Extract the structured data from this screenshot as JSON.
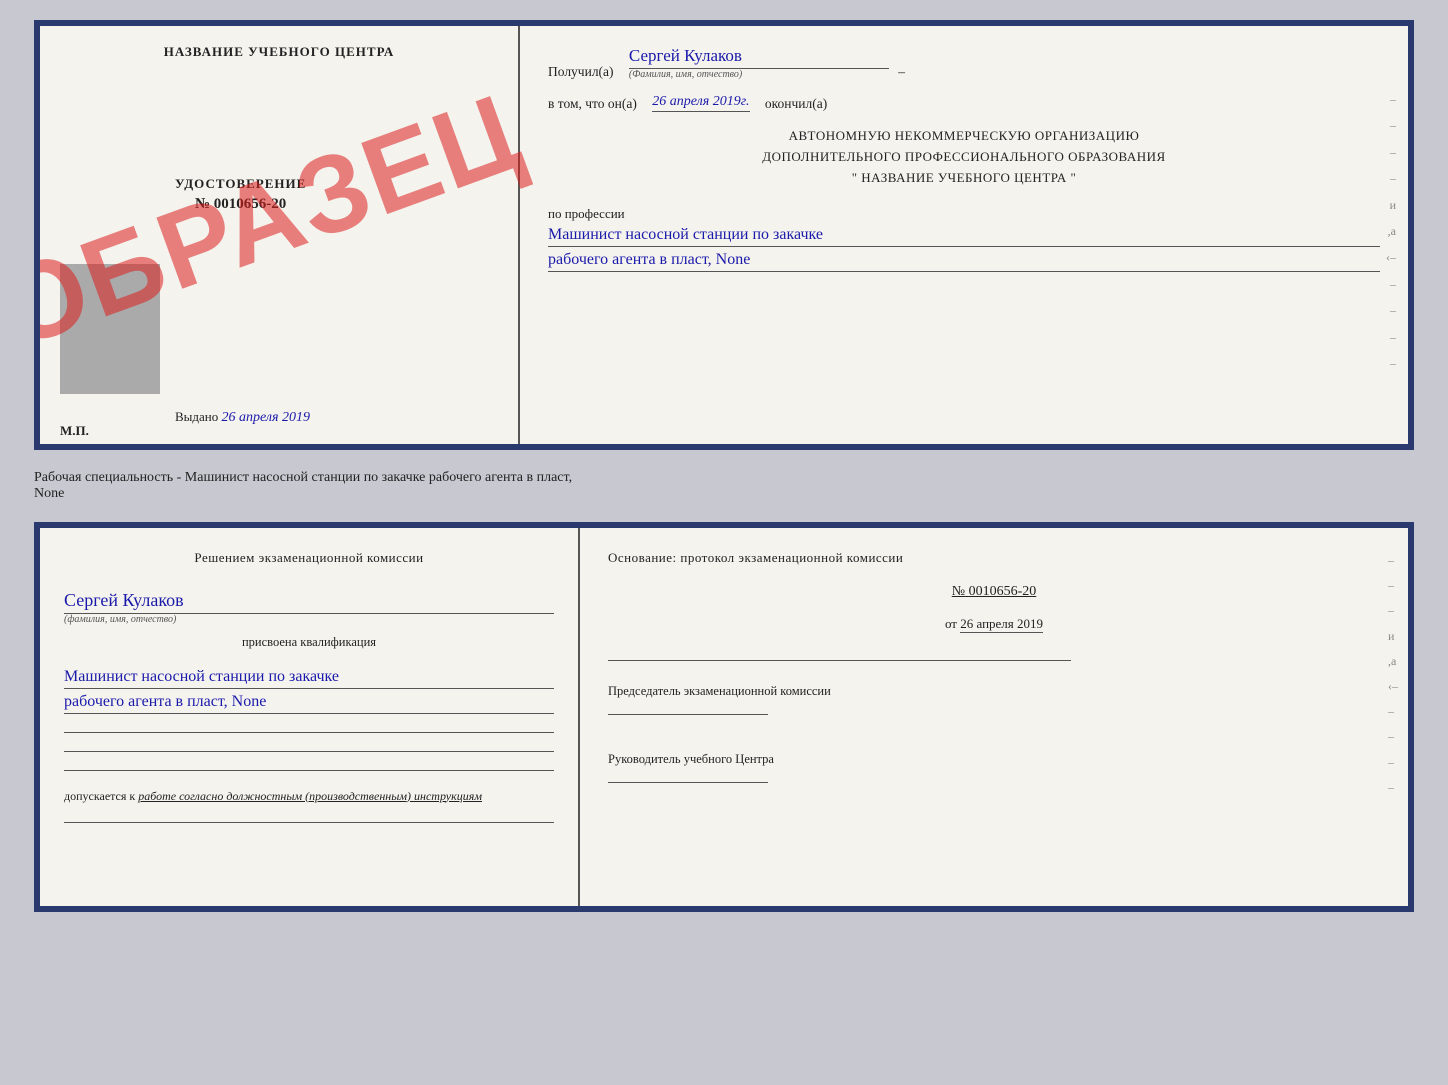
{
  "top_cert": {
    "left": {
      "title": "НАЗВАНИЕ УЧЕБНОГО ЦЕНТРА",
      "stamp": "ОБРАЗЕЦ",
      "udost_label": "УДОСТОВЕРЕНИЕ",
      "udost_num": "№ 0010656-20",
      "vydano_label": "Выдано",
      "vydano_date": "26 апреля 2019",
      "mp_label": "М.П."
    },
    "right": {
      "poluchil_label": "Получил(а)",
      "poluchil_value": "Сергей Кулаков",
      "familiya_label": "(Фамилия, имя, отчество)",
      "vtom_label": "в том, что он(а)",
      "date_value": "26 апреля 2019г.",
      "okonchil_label": "окончил(а)",
      "org_line1": "АВТОНОМНУЮ НЕКОММЕРЧЕСКУЮ ОРГАНИЗАЦИЮ",
      "org_line2": "ДОПОЛНИТЕЛЬНОГО ПРОФЕССИОНАЛЬНОГО ОБРАЗОВАНИЯ",
      "org_line3": "\"  НАЗВАНИЕ УЧЕБНОГО ЦЕНТРА  \"",
      "profession_label": "по профессии",
      "profession_line1": "Машинист насосной станции по закачке",
      "profession_line2": "рабочего агента в пласт, None"
    }
  },
  "caption": {
    "text": "Рабочая специальность - Машинист насосной станции по закачке рабочего агента в пласт,",
    "text2": "None"
  },
  "bottom_cert": {
    "left": {
      "komissia_text": "Решением экзаменационной комиссии",
      "name_value": "Сергей Кулаков",
      "familiya_label": "(фамилия, имя, отчество)",
      "prisvoena_text": "присвоена квалификация",
      "profession_line1": "Машинист насосной станции по закачке",
      "profession_line2": "рабочего агента в пласт, None",
      "dopuskaetsya_label": "допускается к",
      "dopuskaetsya_value": "работе согласно должностным (производственным) инструкциям"
    },
    "right": {
      "osnovanie_text": "Основание: протокол экзаменационной комиссии",
      "num_label": "№",
      "num_value": "0010656-20",
      "ot_label": "от",
      "ot_date": "26 апреля 2019",
      "predsedatel_label": "Председатель экзаменационной комиссии",
      "rukovoditel_label": "Руководитель учебного Центра"
    },
    "right_dashes": [
      "–",
      "–",
      "–",
      "и",
      ",а",
      "‹–",
      "–",
      "–",
      "–",
      "–"
    ]
  }
}
